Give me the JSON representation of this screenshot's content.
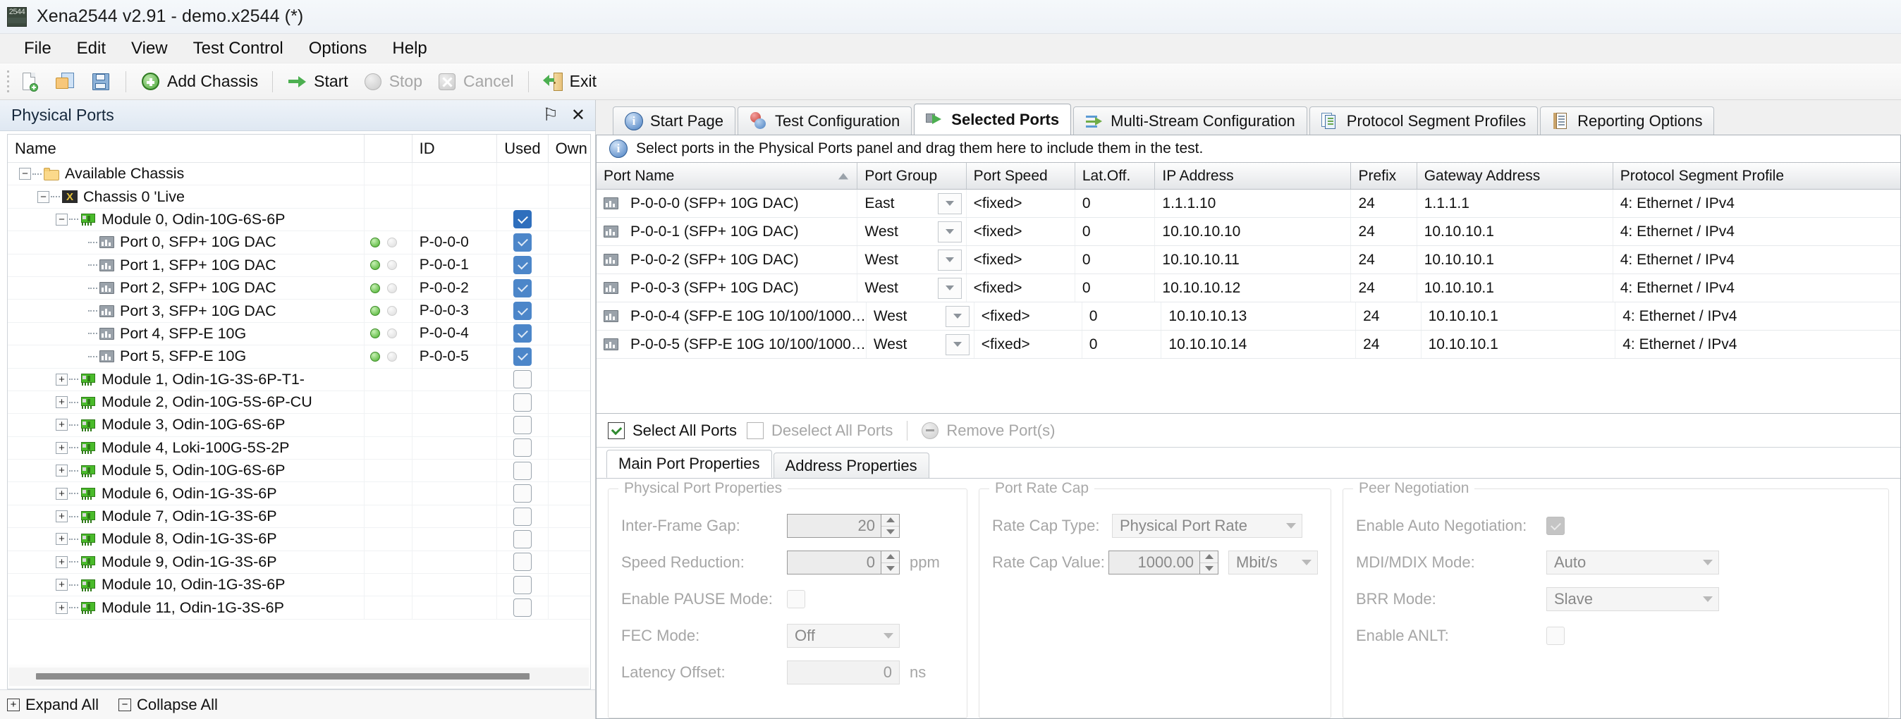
{
  "window": {
    "title": "Xena2544 v2.91 - demo.x2544 (*)",
    "app_icon_text": "2544"
  },
  "menubar": {
    "items": [
      "File",
      "Edit",
      "View",
      "Test Control",
      "Options",
      "Help"
    ]
  },
  "toolbar": {
    "new_icon": "new-document-icon",
    "open_icon": "open-folder-icon",
    "save_icon": "save-icon",
    "add_chassis": "Add Chassis",
    "start": "Start",
    "stop": "Stop",
    "cancel": "Cancel",
    "exit": "Exit"
  },
  "physical_ports": {
    "caption": "Physical Ports",
    "pin_glyph": "⚐",
    "close_glyph": "✕",
    "columns": [
      "Name",
      "",
      "ID",
      "Used",
      "Own"
    ],
    "rows": [
      {
        "label": "Available Chassis",
        "level": 0,
        "icon": "folder-icon",
        "expander": "−",
        "id": "",
        "leds": false,
        "used": null
      },
      {
        "label": "Chassis 0 'Live",
        "level": 1,
        "icon": "chassis-icon",
        "expander": "−",
        "id": "",
        "leds": false,
        "used": null
      },
      {
        "label": "Module 0, Odin-10G-6S-6P",
        "level": 2,
        "icon": "module-icon",
        "expander": "−",
        "id": "",
        "leds": false,
        "used": "checked-dark"
      },
      {
        "label": "Port 0, SFP+ 10G DAC",
        "level": 3,
        "icon": "port-icon",
        "expander": "",
        "id": "P-0-0-0",
        "leds": true,
        "used": "checked"
      },
      {
        "label": "Port 1, SFP+ 10G DAC",
        "level": 3,
        "icon": "port-icon",
        "expander": "",
        "id": "P-0-0-1",
        "leds": true,
        "used": "checked"
      },
      {
        "label": "Port 2, SFP+ 10G DAC",
        "level": 3,
        "icon": "port-icon",
        "expander": "",
        "id": "P-0-0-2",
        "leds": true,
        "used": "checked"
      },
      {
        "label": "Port 3, SFP+ 10G DAC",
        "level": 3,
        "icon": "port-icon",
        "expander": "",
        "id": "P-0-0-3",
        "leds": true,
        "used": "checked"
      },
      {
        "label": "Port 4, SFP-E 10G",
        "level": 3,
        "icon": "port-icon",
        "expander": "",
        "id": "P-0-0-4",
        "leds": true,
        "used": "checked"
      },
      {
        "label": "Port 5, SFP-E 10G",
        "level": 3,
        "icon": "port-icon",
        "expander": "",
        "id": "P-0-0-5",
        "leds": true,
        "used": "checked"
      },
      {
        "label": "Module 1, Odin-1G-3S-6P-T1-",
        "level": 2,
        "icon": "module-icon",
        "expander": "+",
        "id": "",
        "leds": false,
        "used": "unchecked"
      },
      {
        "label": "Module 2, Odin-10G-5S-6P-CU",
        "level": 2,
        "icon": "module-icon",
        "expander": "+",
        "id": "",
        "leds": false,
        "used": "unchecked"
      },
      {
        "label": "Module 3, Odin-10G-6S-6P",
        "level": 2,
        "icon": "module-icon",
        "expander": "+",
        "id": "",
        "leds": false,
        "used": "unchecked"
      },
      {
        "label": "Module 4, Loki-100G-5S-2P",
        "level": 2,
        "icon": "module-icon",
        "expander": "+",
        "id": "",
        "leds": false,
        "used": "unchecked"
      },
      {
        "label": "Module 5, Odin-10G-6S-6P",
        "level": 2,
        "icon": "module-icon",
        "expander": "+",
        "id": "",
        "leds": false,
        "used": "unchecked"
      },
      {
        "label": "Module 6, Odin-1G-3S-6P",
        "level": 2,
        "icon": "module-icon",
        "expander": "+",
        "id": "",
        "leds": false,
        "used": "unchecked"
      },
      {
        "label": "Module 7, Odin-1G-3S-6P",
        "level": 2,
        "icon": "module-icon",
        "expander": "+",
        "id": "",
        "leds": false,
        "used": "unchecked"
      },
      {
        "label": "Module 8, Odin-1G-3S-6P",
        "level": 2,
        "icon": "module-icon",
        "expander": "+",
        "id": "",
        "leds": false,
        "used": "unchecked"
      },
      {
        "label": "Module 9, Odin-1G-3S-6P",
        "level": 2,
        "icon": "module-icon",
        "expander": "+",
        "id": "",
        "leds": false,
        "used": "unchecked"
      },
      {
        "label": "Module 10, Odin-1G-3S-6P",
        "level": 2,
        "icon": "module-icon",
        "expander": "+",
        "id": "",
        "leds": false,
        "used": "unchecked"
      },
      {
        "label": "Module 11, Odin-1G-3S-6P",
        "level": 2,
        "icon": "module-icon",
        "expander": "+",
        "id": "",
        "leds": false,
        "used": "unchecked"
      }
    ],
    "footer": {
      "expand_all": "Expand All",
      "expand_glyph": "+",
      "collapse_all": "Collapse All",
      "collapse_glyph": "−"
    }
  },
  "tabs": [
    {
      "label": "Start Page",
      "icon": "info-icon",
      "active": false
    },
    {
      "label": "Test Configuration",
      "icon": "test-config-icon",
      "active": false
    },
    {
      "label": "Selected Ports",
      "icon": "selected-ports-icon",
      "active": true
    },
    {
      "label": "Multi-Stream Configuration",
      "icon": "multi-stream-icon",
      "active": false
    },
    {
      "label": "Protocol Segment Profiles",
      "icon": "protocol-profiles-icon",
      "active": false
    },
    {
      "label": "Reporting Options",
      "icon": "reporting-options-icon",
      "active": false
    }
  ],
  "selected_ports": {
    "hint": "Select ports in the Physical Ports panel and drag them here to include them in the test.",
    "hint_icon": "info-icon",
    "columns": {
      "port_name": "Port Name",
      "port_group": "Port Group",
      "port_speed": "Port Speed",
      "lat_off": "Lat.Off.",
      "ip_address": "IP Address",
      "prefix": "Prefix",
      "gateway": "Gateway Address",
      "psp": "Protocol Segment Profile"
    },
    "sort_column": "Port Name",
    "rows": [
      {
        "port_name": "P-0-0-0 (SFP+ 10G DAC)",
        "port_group": "East",
        "port_speed": "<fixed>",
        "lat_off": "0",
        "ip": "1.1.1.10",
        "prefix": "24",
        "gateway": "1.1.1.1",
        "psp": "4: Ethernet / IPv4"
      },
      {
        "port_name": "P-0-0-1 (SFP+ 10G DAC)",
        "port_group": "West",
        "port_speed": "<fixed>",
        "lat_off": "0",
        "ip": "10.10.10.10",
        "prefix": "24",
        "gateway": "10.10.10.1",
        "psp": "4: Ethernet / IPv4"
      },
      {
        "port_name": "P-0-0-2 (SFP+ 10G DAC)",
        "port_group": "West",
        "port_speed": "<fixed>",
        "lat_off": "0",
        "ip": "10.10.10.11",
        "prefix": "24",
        "gateway": "10.10.10.1",
        "psp": "4: Ethernet / IPv4"
      },
      {
        "port_name": "P-0-0-3 (SFP+ 10G DAC)",
        "port_group": "West",
        "port_speed": "<fixed>",
        "lat_off": "0",
        "ip": "10.10.10.12",
        "prefix": "24",
        "gateway": "10.10.10.1",
        "psp": "4: Ethernet / IPv4"
      },
      {
        "port_name": "P-0-0-4 (SFP-E 10G  10/100/1000…",
        "port_group": "West",
        "port_speed": "<fixed>",
        "lat_off": "0",
        "ip": "10.10.10.13",
        "prefix": "24",
        "gateway": "10.10.10.1",
        "psp": "4: Ethernet / IPv4"
      },
      {
        "port_name": "P-0-0-5 (SFP-E 10G  10/100/1000…",
        "port_group": "West",
        "port_speed": "<fixed>",
        "lat_off": "0",
        "ip": "10.10.10.14",
        "prefix": "24",
        "gateway": "10.10.10.1",
        "psp": "4: Ethernet / IPv4"
      }
    ]
  },
  "port_actions": {
    "select_all": "Select All Ports",
    "deselect_all": "Deselect All Ports",
    "remove_ports": "Remove Port(s)",
    "remove_icon": "minus-circle-icon"
  },
  "sub_tabs": [
    {
      "label": "Main Port Properties",
      "active": true
    },
    {
      "label": "Address Properties",
      "active": false
    }
  ],
  "physical_port_properties": {
    "legend": "Physical Port Properties",
    "inter_frame_gap": {
      "label": "Inter-Frame Gap:",
      "value": "20"
    },
    "speed_reduction": {
      "label": "Speed Reduction:",
      "value": "0",
      "unit": "ppm"
    },
    "enable_pause_mode": {
      "label": "Enable PAUSE Mode:",
      "checked": false
    },
    "fec_mode": {
      "label": "FEC Mode:",
      "value": "Off"
    },
    "latency_offset": {
      "label": "Latency Offset:",
      "value": "0",
      "unit": "ns"
    }
  },
  "port_rate_cap": {
    "legend": "Port Rate Cap",
    "rate_cap_type": {
      "label": "Rate Cap Type:",
      "value": "Physical Port Rate"
    },
    "rate_cap_value": {
      "label": "Rate Cap Value:",
      "value": "1000.00",
      "unit": "Mbit/s"
    }
  },
  "peer_negotiation": {
    "legend": "Peer Negotiation",
    "enable_auto_negotiation": {
      "label": "Enable Auto Negotiation:",
      "checked": true
    },
    "mdi_mdix_mode": {
      "label": "MDI/MDIX Mode:",
      "value": "Auto"
    },
    "brr_mode": {
      "label": "BRR Mode:",
      "value": "Slave"
    },
    "enable_anlt": {
      "label": "Enable ANLT:",
      "checked": false
    }
  },
  "colors": {
    "accent_blue": "#2f6fbd",
    "led_green": "#49b02c",
    "module_green": "#49bb2a",
    "title_bg": "#eef2f7"
  }
}
